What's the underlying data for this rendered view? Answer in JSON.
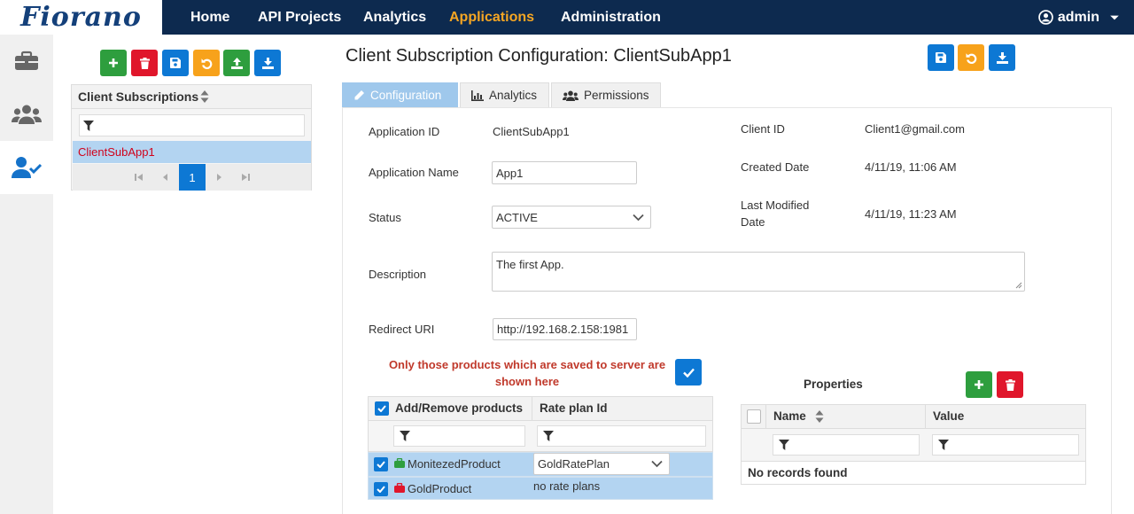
{
  "logo": "Fiorano",
  "nav": {
    "items": [
      "Home",
      "API Projects",
      "Analytics",
      "Applications",
      "Administration"
    ],
    "active": "Applications",
    "user": "admin"
  },
  "rail": {
    "icons": [
      "briefcase-icon",
      "users-icon",
      "user-check-icon"
    ]
  },
  "sub_panel": {
    "header": "Client Subscriptions",
    "rows": [
      "ClientSubApp1"
    ],
    "current_page": "1"
  },
  "page": {
    "title": "Client Subscription Configuration: ClientSubApp1",
    "tabs": [
      "Configuration",
      "Analytics",
      "Permissions"
    ]
  },
  "form": {
    "app_id_label": "Application ID",
    "app_id_value": "ClientSubApp1",
    "app_name_label": "Application Name",
    "app_name_value": "App1",
    "status_label": "Status",
    "status_value": "ACTIVE",
    "description_label": "Description",
    "description_value": "The first App.",
    "redirect_label": "Redirect URI",
    "redirect_value": "http://192.168.2.158:1981",
    "client_id_label": "Client ID",
    "client_id_value": "Client1@gmail.com",
    "created_label": "Created Date",
    "created_value": "4/11/19, 11:06 AM",
    "modified_label_1": "Last Modified",
    "modified_label_2": "Date",
    "modified_value": "4/11/19, 11:23 AM"
  },
  "products": {
    "notice_1": "Only those products which are saved to server are",
    "notice_2": "shown here",
    "col_add": "Add/Remove products",
    "col_rate": "Rate plan Id",
    "rows": [
      {
        "name": "MonitezedProduct",
        "rate": "GoldRatePlan",
        "icon_color": "#2e9e3e"
      },
      {
        "name": "GoldProduct",
        "rate": "no rate plans",
        "icon_color": "#e0162b"
      }
    ]
  },
  "properties": {
    "title": "Properties",
    "col_name": "Name",
    "col_value": "Value",
    "empty": "No records found"
  },
  "colors": {
    "nav_bg": "#0d2a4f",
    "active_nav": "#f5a623",
    "blue": "#0d78d4",
    "green": "#2e9e3e",
    "red": "#e0162b",
    "orange": "#f7a21b",
    "notice": "#c0392b",
    "selected_row": "#b3d4f1"
  }
}
